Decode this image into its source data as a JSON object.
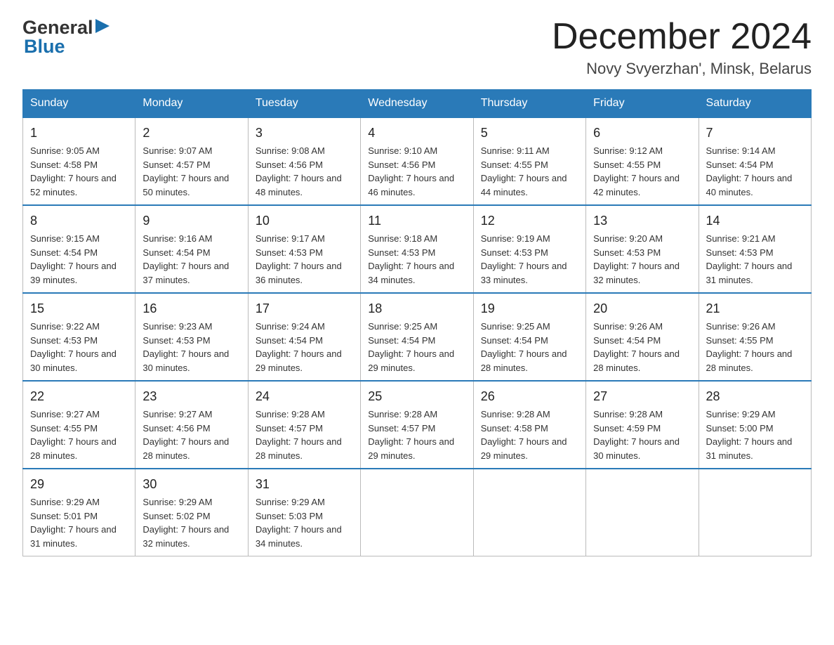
{
  "header": {
    "logo": {
      "general": "General",
      "blue": "Blue",
      "triangle": "▶"
    },
    "month_title": "December 2024",
    "location": "Novy Svyerzhan', Minsk, Belarus"
  },
  "calendar": {
    "days_of_week": [
      "Sunday",
      "Monday",
      "Tuesday",
      "Wednesday",
      "Thursday",
      "Friday",
      "Saturday"
    ],
    "weeks": [
      [
        {
          "day": "1",
          "sunrise": "Sunrise: 9:05 AM",
          "sunset": "Sunset: 4:58 PM",
          "daylight": "Daylight: 7 hours and 52 minutes."
        },
        {
          "day": "2",
          "sunrise": "Sunrise: 9:07 AM",
          "sunset": "Sunset: 4:57 PM",
          "daylight": "Daylight: 7 hours and 50 minutes."
        },
        {
          "day": "3",
          "sunrise": "Sunrise: 9:08 AM",
          "sunset": "Sunset: 4:56 PM",
          "daylight": "Daylight: 7 hours and 48 minutes."
        },
        {
          "day": "4",
          "sunrise": "Sunrise: 9:10 AM",
          "sunset": "Sunset: 4:56 PM",
          "daylight": "Daylight: 7 hours and 46 minutes."
        },
        {
          "day": "5",
          "sunrise": "Sunrise: 9:11 AM",
          "sunset": "Sunset: 4:55 PM",
          "daylight": "Daylight: 7 hours and 44 minutes."
        },
        {
          "day": "6",
          "sunrise": "Sunrise: 9:12 AM",
          "sunset": "Sunset: 4:55 PM",
          "daylight": "Daylight: 7 hours and 42 minutes."
        },
        {
          "day": "7",
          "sunrise": "Sunrise: 9:14 AM",
          "sunset": "Sunset: 4:54 PM",
          "daylight": "Daylight: 7 hours and 40 minutes."
        }
      ],
      [
        {
          "day": "8",
          "sunrise": "Sunrise: 9:15 AM",
          "sunset": "Sunset: 4:54 PM",
          "daylight": "Daylight: 7 hours and 39 minutes."
        },
        {
          "day": "9",
          "sunrise": "Sunrise: 9:16 AM",
          "sunset": "Sunset: 4:54 PM",
          "daylight": "Daylight: 7 hours and 37 minutes."
        },
        {
          "day": "10",
          "sunrise": "Sunrise: 9:17 AM",
          "sunset": "Sunset: 4:53 PM",
          "daylight": "Daylight: 7 hours and 36 minutes."
        },
        {
          "day": "11",
          "sunrise": "Sunrise: 9:18 AM",
          "sunset": "Sunset: 4:53 PM",
          "daylight": "Daylight: 7 hours and 34 minutes."
        },
        {
          "day": "12",
          "sunrise": "Sunrise: 9:19 AM",
          "sunset": "Sunset: 4:53 PM",
          "daylight": "Daylight: 7 hours and 33 minutes."
        },
        {
          "day": "13",
          "sunrise": "Sunrise: 9:20 AM",
          "sunset": "Sunset: 4:53 PM",
          "daylight": "Daylight: 7 hours and 32 minutes."
        },
        {
          "day": "14",
          "sunrise": "Sunrise: 9:21 AM",
          "sunset": "Sunset: 4:53 PM",
          "daylight": "Daylight: 7 hours and 31 minutes."
        }
      ],
      [
        {
          "day": "15",
          "sunrise": "Sunrise: 9:22 AM",
          "sunset": "Sunset: 4:53 PM",
          "daylight": "Daylight: 7 hours and 30 minutes."
        },
        {
          "day": "16",
          "sunrise": "Sunrise: 9:23 AM",
          "sunset": "Sunset: 4:53 PM",
          "daylight": "Daylight: 7 hours and 30 minutes."
        },
        {
          "day": "17",
          "sunrise": "Sunrise: 9:24 AM",
          "sunset": "Sunset: 4:54 PM",
          "daylight": "Daylight: 7 hours and 29 minutes."
        },
        {
          "day": "18",
          "sunrise": "Sunrise: 9:25 AM",
          "sunset": "Sunset: 4:54 PM",
          "daylight": "Daylight: 7 hours and 29 minutes."
        },
        {
          "day": "19",
          "sunrise": "Sunrise: 9:25 AM",
          "sunset": "Sunset: 4:54 PM",
          "daylight": "Daylight: 7 hours and 28 minutes."
        },
        {
          "day": "20",
          "sunrise": "Sunrise: 9:26 AM",
          "sunset": "Sunset: 4:54 PM",
          "daylight": "Daylight: 7 hours and 28 minutes."
        },
        {
          "day": "21",
          "sunrise": "Sunrise: 9:26 AM",
          "sunset": "Sunset: 4:55 PM",
          "daylight": "Daylight: 7 hours and 28 minutes."
        }
      ],
      [
        {
          "day": "22",
          "sunrise": "Sunrise: 9:27 AM",
          "sunset": "Sunset: 4:55 PM",
          "daylight": "Daylight: 7 hours and 28 minutes."
        },
        {
          "day": "23",
          "sunrise": "Sunrise: 9:27 AM",
          "sunset": "Sunset: 4:56 PM",
          "daylight": "Daylight: 7 hours and 28 minutes."
        },
        {
          "day": "24",
          "sunrise": "Sunrise: 9:28 AM",
          "sunset": "Sunset: 4:57 PM",
          "daylight": "Daylight: 7 hours and 28 minutes."
        },
        {
          "day": "25",
          "sunrise": "Sunrise: 9:28 AM",
          "sunset": "Sunset: 4:57 PM",
          "daylight": "Daylight: 7 hours and 29 minutes."
        },
        {
          "day": "26",
          "sunrise": "Sunrise: 9:28 AM",
          "sunset": "Sunset: 4:58 PM",
          "daylight": "Daylight: 7 hours and 29 minutes."
        },
        {
          "day": "27",
          "sunrise": "Sunrise: 9:28 AM",
          "sunset": "Sunset: 4:59 PM",
          "daylight": "Daylight: 7 hours and 30 minutes."
        },
        {
          "day": "28",
          "sunrise": "Sunrise: 9:29 AM",
          "sunset": "Sunset: 5:00 PM",
          "daylight": "Daylight: 7 hours and 31 minutes."
        }
      ],
      [
        {
          "day": "29",
          "sunrise": "Sunrise: 9:29 AM",
          "sunset": "Sunset: 5:01 PM",
          "daylight": "Daylight: 7 hours and 31 minutes."
        },
        {
          "day": "30",
          "sunrise": "Sunrise: 9:29 AM",
          "sunset": "Sunset: 5:02 PM",
          "daylight": "Daylight: 7 hours and 32 minutes."
        },
        {
          "day": "31",
          "sunrise": "Sunrise: 9:29 AM",
          "sunset": "Sunset: 5:03 PM",
          "daylight": "Daylight: 7 hours and 34 minutes."
        },
        null,
        null,
        null,
        null
      ]
    ]
  }
}
